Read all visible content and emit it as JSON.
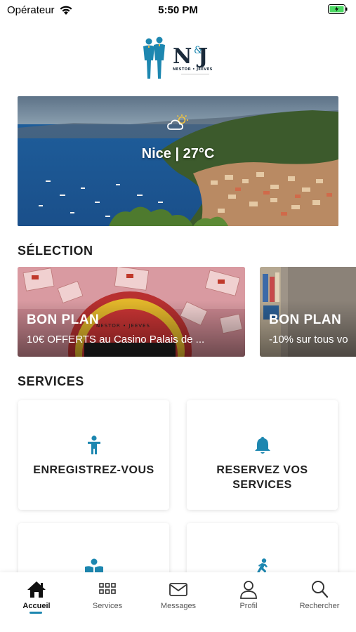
{
  "status": {
    "carrier": "Opérateur",
    "time": "5:50 PM"
  },
  "logo": {
    "monogram_left": "N",
    "monogram_amp": "&",
    "monogram_right": "J",
    "wordmark": "NESTOR • JEEVES"
  },
  "hero": {
    "weather_text": "Nice | 27°C"
  },
  "sections": {
    "selection_title": "SÉLECTION",
    "services_title": "SERVICES"
  },
  "selection_cards": [
    {
      "title": "BON PLAN",
      "subtitle": "10€ OFFERTS au Casino Palais de ..."
    },
    {
      "title": "BON PLAN",
      "subtitle": "-10% sur tous vo"
    }
  ],
  "services": [
    {
      "label": "ENREGISTREZ-VOUS",
      "icon": "person-icon"
    },
    {
      "label": "RESERVEZ VOS SERVICES",
      "icon": "bell-icon"
    },
    {
      "label": "",
      "icon": "reader-icon"
    },
    {
      "label": "",
      "icon": "running-person-icon"
    }
  ],
  "tabs": [
    {
      "label": "Accueil",
      "icon": "home-icon",
      "active": true
    },
    {
      "label": "Services",
      "icon": "grid-icon"
    },
    {
      "label": "Messages",
      "icon": "envelope-icon"
    },
    {
      "label": "Profil",
      "icon": "user-icon"
    },
    {
      "label": "Rechercher",
      "icon": "search-icon"
    }
  ],
  "colors": {
    "accent": "#1d87b0",
    "battery": "#4cd964"
  }
}
